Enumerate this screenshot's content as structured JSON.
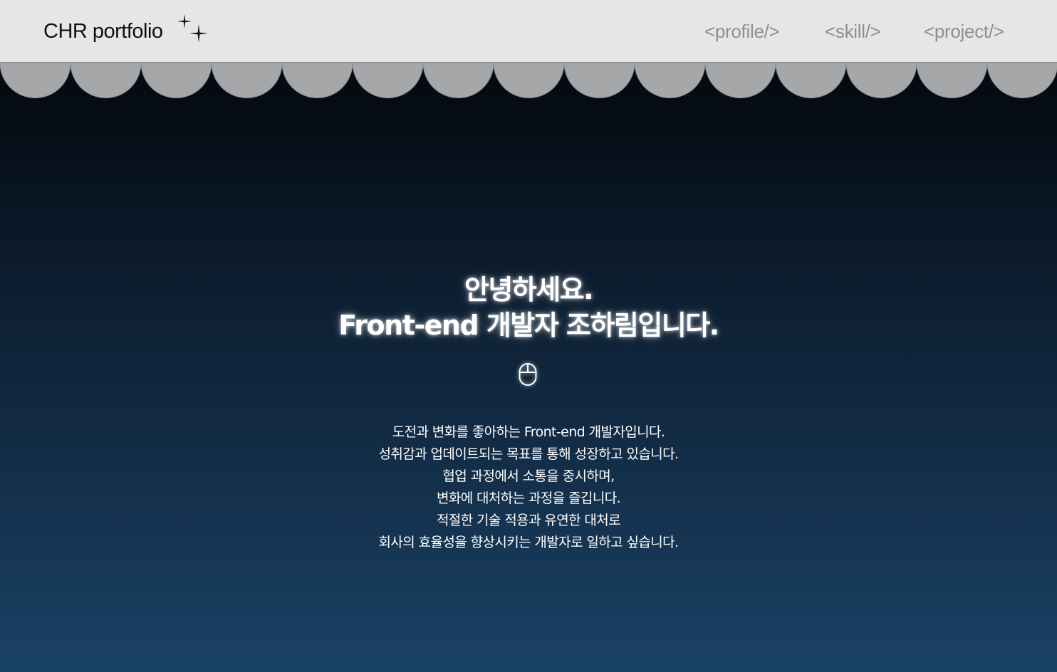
{
  "header": {
    "brand": "CHR portfolio",
    "brand_icon": "sparkle-icon",
    "nav": [
      {
        "label": "<profile/>"
      },
      {
        "label": "<skill/>"
      },
      {
        "label": "<project/>"
      }
    ]
  },
  "hero": {
    "title_line1": "안녕하세요.",
    "title_line2": "Front-end 개발자 조하림입니다.",
    "scroll_icon": "mouse-icon"
  },
  "intro": {
    "lines": [
      "도전과 변화를 좋아하는 Front-end 개발자입니다.",
      "성취감과 업데이트되는 목표를 통해 성장하고 있습니다.",
      "협업 과정에서 소통을 중시하며,",
      "변화에 대처하는 과정을 즐깁니다.",
      "적절한 기술 적용과 유연한 대처로",
      "회사의 효율성을 향상시키는 개발자로 일하고 싶습니다."
    ]
  },
  "colors": {
    "header_bg": "#e6e6e6",
    "scallop": "#a6a7a8",
    "nav_text": "#8e8e8e",
    "bg_top": "#03070b",
    "bg_bottom": "#1a4266"
  }
}
